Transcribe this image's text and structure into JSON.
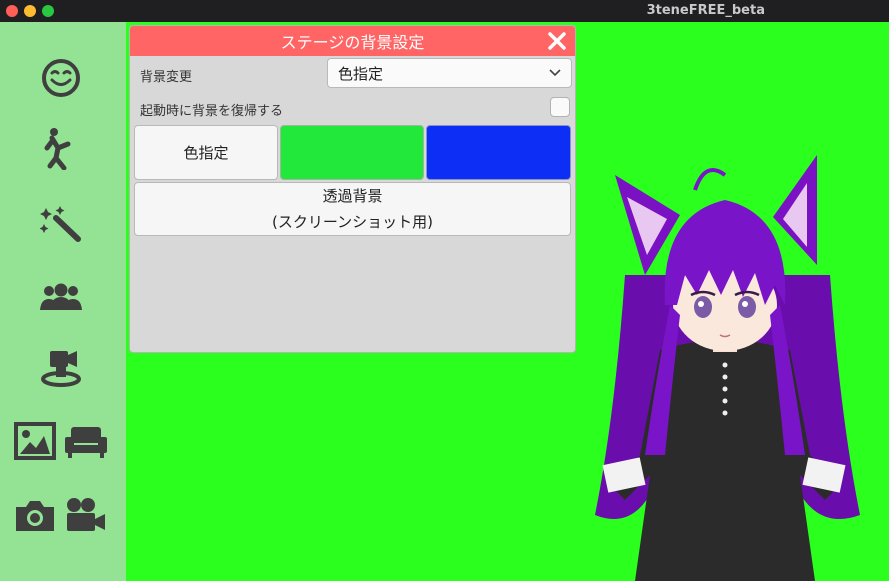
{
  "window": {
    "title": "3teneFREE_beta"
  },
  "sidebar": {
    "items": [
      {
        "icon": "smiley-face-icon"
      },
      {
        "icon": "dancing-person-icon"
      },
      {
        "icon": "magic-wand-icon"
      },
      {
        "icon": "group-people-icon"
      },
      {
        "icon": "video-camera-stage-icon"
      },
      {
        "icon": "image-icon"
      },
      {
        "icon": "sofa-icon"
      },
      {
        "icon": "photo-camera-icon"
      },
      {
        "icon": "movie-camera-icon"
      }
    ]
  },
  "panel": {
    "title": "ステージの背景設定",
    "close_glyph": "✕",
    "background_change_label": "背景変更",
    "background_select_value": "色指定",
    "restore_on_start_label": "起動時に背景を復帰する",
    "restore_on_start_checked": false,
    "color_button_label": "色指定",
    "swatches": [
      {
        "name": "green",
        "color": "#22e83c"
      },
      {
        "name": "blue",
        "color": "#0c2ef5"
      }
    ],
    "transparent_line1": "透過背景",
    "transparent_line2": "(スクリーンショット用)"
  },
  "colors": {
    "stage_background": "#2aff1e",
    "sidebar": "#94e394",
    "panel_header": "#ff6565",
    "panel_body": "#d8d8d8"
  }
}
